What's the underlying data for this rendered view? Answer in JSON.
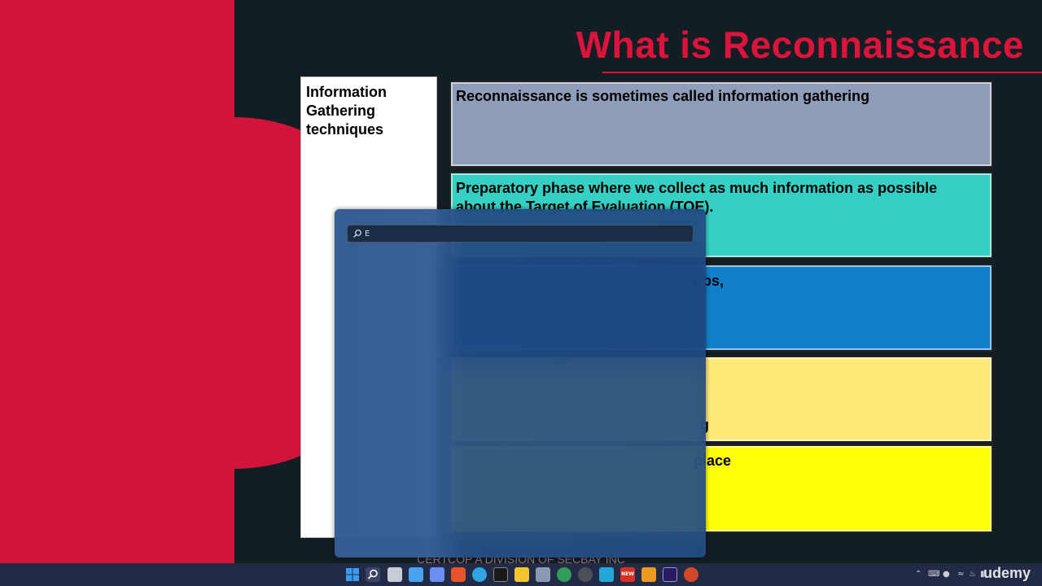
{
  "slide": {
    "title": "What is Reconnaissance",
    "left_cell_text": "Information Gathering techniques",
    "rows": [
      {
        "text": "Reconnaissance is sometimes called information gathering",
        "color": "#8e9db8"
      },
      {
        "text": "Preparatory phase where we collect as much information as possible\nabout the Target of Evaluation (TOE).",
        "color": "#35cfc4"
      },
      {
        "text": "ups,",
        "color": "#127fcc"
      },
      {
        "text": "g",
        "color": "#fde878"
      },
      {
        "text": "place",
        "color": "#ffff0a"
      }
    ],
    "footer": "CERTCOP A DIVISION OF SECBAY INC"
  },
  "search": {
    "query": "E"
  },
  "taskbar": {
    "icons": [
      {
        "name": "windows-start-icon",
        "color": "#3a8ee6"
      },
      {
        "name": "search-icon",
        "color": "#5b6480"
      },
      {
        "name": "task-view-icon",
        "color": "#c8ccd6"
      },
      {
        "name": "widgets-icon",
        "color": "#4aa3f0"
      },
      {
        "name": "teams-icon",
        "color": "#6b8cf0"
      },
      {
        "name": "brave-icon",
        "color": "#e8542a"
      },
      {
        "name": "edge-icon",
        "color": "#2fa4e0"
      },
      {
        "name": "terminal-icon",
        "color": "#1a1a1a"
      },
      {
        "name": "file-explorer-icon",
        "color": "#f2c530"
      },
      {
        "name": "app-icon",
        "color": "#8a9ab0"
      },
      {
        "name": "spreadsheet-icon",
        "color": "#2f9e5a"
      },
      {
        "name": "chrome-icon",
        "color": "#4b4f56"
      },
      {
        "name": "app-s-icon",
        "color": "#25a6d9"
      },
      {
        "name": "red-app-icon",
        "color": "#d93025"
      },
      {
        "name": "sublime-icon",
        "color": "#ee9a21"
      },
      {
        "name": "premiere-icon",
        "color": "#2a1a5e"
      },
      {
        "name": "powerpoint-icon",
        "color": "#d24726"
      }
    ],
    "badge_text": "NEW"
  },
  "watermark": "udemy"
}
